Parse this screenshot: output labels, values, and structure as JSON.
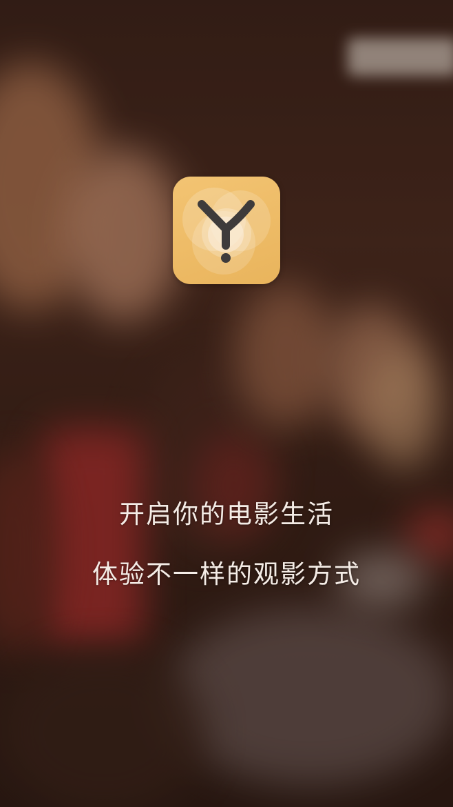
{
  "splash": {
    "logo_icon": "y-letter-app-icon",
    "tagline_primary": "开启你的电影生活",
    "tagline_secondary": "体验不一样的观影方式"
  },
  "colors": {
    "logo_background": "#efbd68",
    "logo_glyph": "#3e3b3b",
    "text": "#f4ece6"
  }
}
